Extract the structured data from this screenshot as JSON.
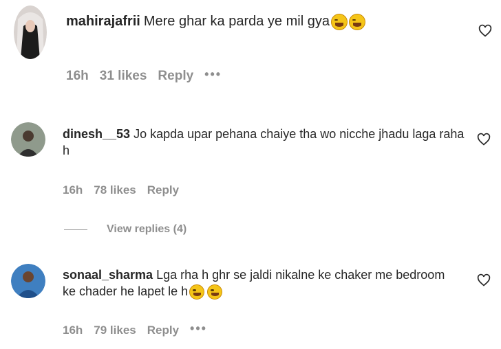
{
  "comments": [
    {
      "username": "mahirajafrii",
      "text": "Mere ghar ka parda ye mil gya",
      "emojis": [
        "laughing-face",
        "laughing-face"
      ],
      "time": "16h",
      "likes": "31 likes",
      "reply": "Reply",
      "more": "•••"
    },
    {
      "username": "dinesh__53",
      "text": "Jo kapda upar pehana chaiye tha wo nicche jhadu laga raha h",
      "emojis": [],
      "time": "16h",
      "likes": "78 likes",
      "reply": "Reply",
      "view_replies": "View replies (4)"
    },
    {
      "username": "sonaal_sharma",
      "text": "Lga rha h ghr se jaldi nikalne ke chaker me bedroom ke chader he lapet le h",
      "emojis": [
        "laughing-face",
        "laughing-face"
      ],
      "time": "16h",
      "likes": "79 likes",
      "reply": "Reply",
      "more": "•••"
    }
  ],
  "colors": {
    "text": "#262626",
    "meta": "#8e8e8e",
    "emoji": "#f5c518"
  },
  "icons": {
    "like": "heart-outline-icon",
    "avatar": "user-avatar"
  }
}
